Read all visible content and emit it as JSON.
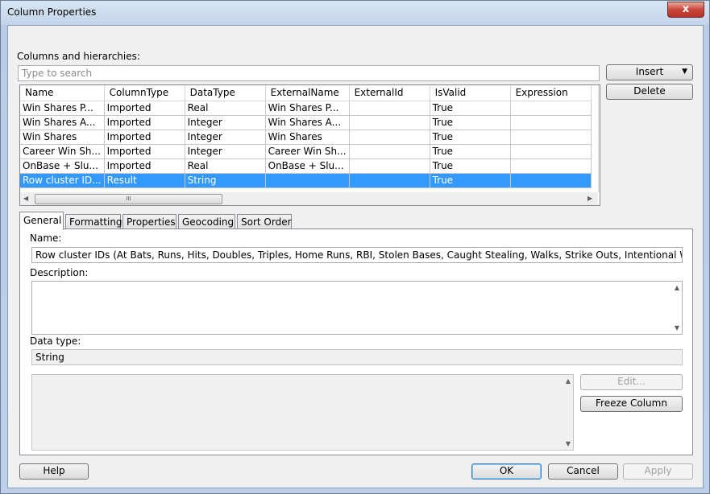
{
  "window": {
    "title": "Column Properties",
    "close_symbol": "x"
  },
  "columns_section": {
    "label": "Columns and hierarchies:",
    "search_placeholder": "Type to search"
  },
  "buttons": {
    "insert": "Insert",
    "delete": "Delete",
    "edit": "Edit...",
    "freeze_column": "Freeze Column",
    "help": "Help",
    "ok": "OK",
    "cancel": "Cancel",
    "apply": "Apply"
  },
  "grid": {
    "headers": [
      "Name",
      "ColumnType",
      "DataType",
      "ExternalName",
      "ExternalId",
      "IsValid",
      "Expression"
    ],
    "rows": [
      [
        "Win Shares P...",
        "Imported",
        "Real",
        "Win Shares P...",
        "",
        "True",
        ""
      ],
      [
        "Win Shares A...",
        "Imported",
        "Integer",
        "Win Shares A...",
        "",
        "True",
        ""
      ],
      [
        "Win Shares",
        "Imported",
        "Integer",
        "Win Shares",
        "",
        "True",
        ""
      ],
      [
        "Career Win Sh...",
        "Imported",
        "Integer",
        "Career Win Sh...",
        "",
        "True",
        ""
      ],
      [
        "OnBase + Slu...",
        "Imported",
        "Real",
        "OnBase + Slu...",
        "",
        "True",
        ""
      ],
      [
        "Row cluster ID...",
        "Result",
        "String",
        "",
        "",
        "True",
        ""
      ]
    ],
    "selected_row_index": 5,
    "hscroll_grip": "III"
  },
  "tabs": [
    "General",
    "Formatting",
    "Properties",
    "Geocoding",
    "Sort Order"
  ],
  "active_tab": "General",
  "general": {
    "name_label": "Name:",
    "name_value": "Row cluster IDs (At Bats, Runs, Hits, Doubles, Triples, Home Runs, RBI, Stolen Bases, Caught Stealing, Walks, Strike Outs, Intentional Walks,",
    "description_label": "Description:",
    "description_value": "",
    "data_type_label": "Data type:",
    "data_type_value": "String"
  },
  "colors": {
    "selection": "#3399ff",
    "close_button": "#c8463a"
  }
}
